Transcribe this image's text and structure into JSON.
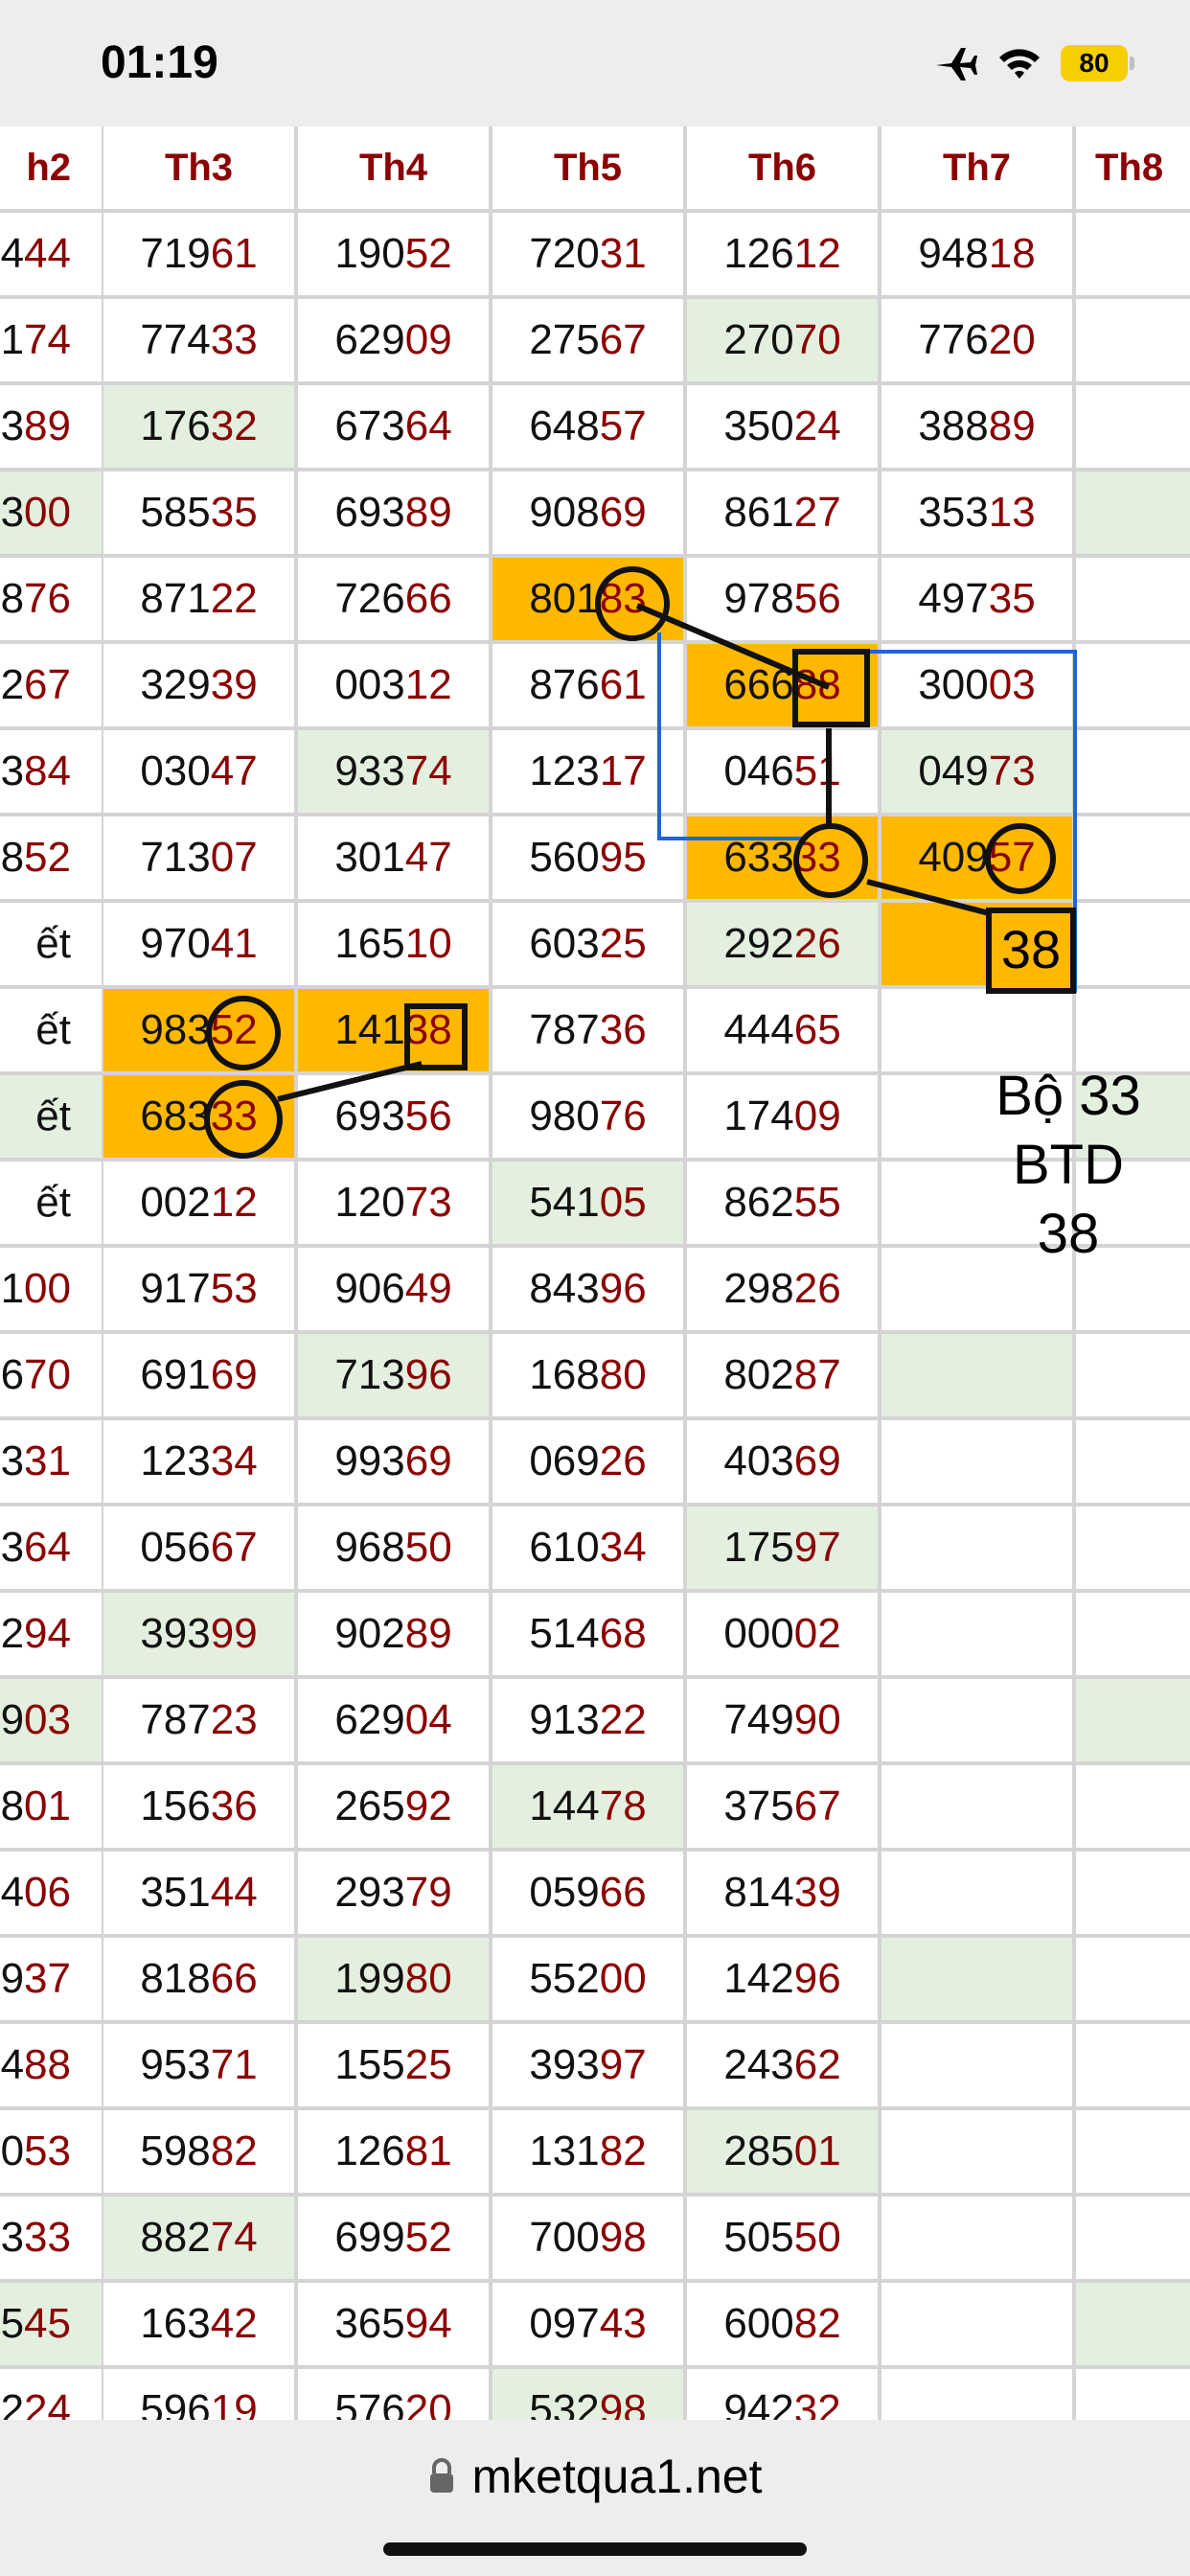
{
  "status": {
    "time": "01:19",
    "battery": "80"
  },
  "headers": [
    "h2",
    "Th3",
    "Th4",
    "Th5",
    "Th6",
    "Th7",
    "Th8"
  ],
  "rows": [
    {
      "c": [
        [
          "4",
          "44"
        ],
        [
          "719",
          "61"
        ],
        [
          "190",
          "52"
        ],
        [
          "720",
          "31"
        ],
        [
          "126",
          "12"
        ],
        [
          "948",
          "18"
        ],
        [
          "",
          ""
        ]
      ]
    },
    {
      "c": [
        [
          "1",
          "74"
        ],
        [
          "774",
          "33"
        ],
        [
          "629",
          "09"
        ],
        [
          "275",
          "67"
        ],
        [
          "270",
          "70"
        ],
        [
          "776",
          "20"
        ],
        [
          "",
          ""
        ]
      ]
    },
    {
      "c": [
        [
          "3",
          "89"
        ],
        [
          "176",
          "32"
        ],
        [
          "673",
          "64"
        ],
        [
          "648",
          "57"
        ],
        [
          "350",
          "24"
        ],
        [
          "388",
          "89"
        ],
        [
          "",
          ""
        ]
      ]
    },
    {
      "c": [
        [
          "3",
          "00"
        ],
        [
          "585",
          "35"
        ],
        [
          "693",
          "89"
        ],
        [
          "908",
          "69"
        ],
        [
          "861",
          "27"
        ],
        [
          "353",
          "13"
        ],
        [
          "",
          ""
        ]
      ]
    },
    {
      "c": [
        [
          "8",
          "76"
        ],
        [
          "871",
          "22"
        ],
        [
          "726",
          "66"
        ],
        [
          "801",
          "83"
        ],
        [
          "978",
          "56"
        ],
        [
          "497",
          "35"
        ],
        [
          "",
          ""
        ]
      ]
    },
    {
      "c": [
        [
          "2",
          "67"
        ],
        [
          "329",
          "39"
        ],
        [
          "003",
          "12"
        ],
        [
          "876",
          "61"
        ],
        [
          "666",
          "88"
        ],
        [
          "300",
          "03"
        ],
        [
          "",
          ""
        ]
      ]
    },
    {
      "c": [
        [
          "3",
          "84"
        ],
        [
          "030",
          "47"
        ],
        [
          "933",
          "74"
        ],
        [
          "123",
          "17"
        ],
        [
          "046",
          "51"
        ],
        [
          "049",
          "73"
        ],
        [
          "",
          ""
        ]
      ]
    },
    {
      "c": [
        [
          "8",
          "52"
        ],
        [
          "713",
          "07"
        ],
        [
          "301",
          "47"
        ],
        [
          "560",
          "95"
        ],
        [
          "633",
          "33"
        ],
        [
          "409",
          "57"
        ],
        [
          "",
          ""
        ]
      ]
    },
    {
      "c": [
        [
          "ết",
          ""
        ],
        [
          "970",
          "41"
        ],
        [
          "165",
          "10"
        ],
        [
          "603",
          "25"
        ],
        [
          "292",
          "26"
        ],
        [
          "",
          ""
        ],
        [
          "",
          ""
        ]
      ]
    },
    {
      "c": [
        [
          "ết",
          ""
        ],
        [
          "983",
          "52"
        ],
        [
          "141",
          "38"
        ],
        [
          "787",
          "36"
        ],
        [
          "444",
          "65"
        ],
        [
          "",
          ""
        ],
        [
          "",
          ""
        ]
      ]
    },
    {
      "c": [
        [
          "ết",
          ""
        ],
        [
          "683",
          "33"
        ],
        [
          "693",
          "56"
        ],
        [
          "980",
          "76"
        ],
        [
          "174",
          "09"
        ],
        [
          "",
          ""
        ],
        [
          "",
          ""
        ]
      ]
    },
    {
      "c": [
        [
          "ết",
          ""
        ],
        [
          "002",
          "12"
        ],
        [
          "120",
          "73"
        ],
        [
          "541",
          "05"
        ],
        [
          "862",
          "55"
        ],
        [
          "",
          ""
        ],
        [
          "",
          ""
        ]
      ]
    },
    {
      "c": [
        [
          "1",
          "00"
        ],
        [
          "917",
          "53"
        ],
        [
          "906",
          "49"
        ],
        [
          "843",
          "96"
        ],
        [
          "298",
          "26"
        ],
        [
          "",
          ""
        ],
        [
          "",
          ""
        ]
      ]
    },
    {
      "c": [
        [
          "6",
          "70"
        ],
        [
          "691",
          "69"
        ],
        [
          "713",
          "96"
        ],
        [
          "168",
          "80"
        ],
        [
          "802",
          "87"
        ],
        [
          "",
          ""
        ],
        [
          "",
          ""
        ]
      ]
    },
    {
      "c": [
        [
          "3",
          "31"
        ],
        [
          "123",
          "34"
        ],
        [
          "993",
          "69"
        ],
        [
          "069",
          "26"
        ],
        [
          "403",
          "69"
        ],
        [
          "",
          ""
        ],
        [
          "",
          ""
        ]
      ]
    },
    {
      "c": [
        [
          "3",
          "64"
        ],
        [
          "056",
          "67"
        ],
        [
          "968",
          "50"
        ],
        [
          "610",
          "34"
        ],
        [
          "175",
          "97"
        ],
        [
          "",
          ""
        ],
        [
          "",
          ""
        ]
      ]
    },
    {
      "c": [
        [
          "2",
          "94"
        ],
        [
          "393",
          "99"
        ],
        [
          "902",
          "89"
        ],
        [
          "514",
          "68"
        ],
        [
          "000",
          "02"
        ],
        [
          "",
          ""
        ],
        [
          "",
          ""
        ]
      ]
    },
    {
      "c": [
        [
          "9",
          "03"
        ],
        [
          "787",
          "23"
        ],
        [
          "629",
          "04"
        ],
        [
          "913",
          "22"
        ],
        [
          "749",
          "90"
        ],
        [
          "",
          ""
        ],
        [
          "",
          ""
        ]
      ]
    },
    {
      "c": [
        [
          "8",
          "01"
        ],
        [
          "156",
          "36"
        ],
        [
          "265",
          "92"
        ],
        [
          "144",
          "78"
        ],
        [
          "375",
          "67"
        ],
        [
          "",
          ""
        ],
        [
          "",
          ""
        ]
      ]
    },
    {
      "c": [
        [
          "4",
          "06"
        ],
        [
          "351",
          "44"
        ],
        [
          "293",
          "79"
        ],
        [
          "059",
          "66"
        ],
        [
          "814",
          "39"
        ],
        [
          "",
          ""
        ],
        [
          "",
          ""
        ]
      ]
    },
    {
      "c": [
        [
          "9",
          "37"
        ],
        [
          "818",
          "66"
        ],
        [
          "199",
          "80"
        ],
        [
          "552",
          "00"
        ],
        [
          "142",
          "96"
        ],
        [
          "",
          ""
        ],
        [
          "",
          ""
        ]
      ]
    },
    {
      "c": [
        [
          "4",
          "88"
        ],
        [
          "953",
          "71"
        ],
        [
          "155",
          "25"
        ],
        [
          "393",
          "97"
        ],
        [
          "243",
          "62"
        ],
        [
          "",
          ""
        ],
        [
          "",
          ""
        ]
      ]
    },
    {
      "c": [
        [
          "0",
          "53"
        ],
        [
          "598",
          "82"
        ],
        [
          "126",
          "81"
        ],
        [
          "131",
          "82"
        ],
        [
          "285",
          "01"
        ],
        [
          "",
          ""
        ],
        [
          "",
          ""
        ]
      ]
    },
    {
      "c": [
        [
          "3",
          "33"
        ],
        [
          "882",
          "74"
        ],
        [
          "699",
          "52"
        ],
        [
          "700",
          "98"
        ],
        [
          "505",
          "50"
        ],
        [
          "",
          ""
        ],
        [
          "",
          ""
        ]
      ]
    },
    {
      "c": [
        [
          "5",
          "45"
        ],
        [
          "163",
          "42"
        ],
        [
          "365",
          "94"
        ],
        [
          "097",
          "43"
        ],
        [
          "600",
          "82"
        ],
        [
          "",
          ""
        ],
        [
          "",
          ""
        ]
      ]
    },
    {
      "c": [
        [
          "2",
          "24"
        ],
        [
          "596",
          "19"
        ],
        [
          "576",
          "20"
        ],
        [
          "532",
          "98"
        ],
        [
          "942",
          "32"
        ],
        [
          "",
          ""
        ],
        [
          "",
          ""
        ]
      ]
    }
  ],
  "highlights": {
    "green": [
      [
        1,
        4
      ],
      [
        2,
        1
      ],
      [
        3,
        0
      ],
      [
        3,
        6
      ],
      [
        6,
        2
      ],
      [
        6,
        5
      ],
      [
        8,
        4
      ],
      [
        10,
        0
      ],
      [
        10,
        6
      ],
      [
        11,
        3
      ],
      [
        13,
        2
      ],
      [
        13,
        5
      ],
      [
        15,
        4
      ],
      [
        16,
        1
      ],
      [
        17,
        0
      ],
      [
        17,
        6
      ],
      [
        18,
        3
      ],
      [
        20,
        2
      ],
      [
        20,
        5
      ],
      [
        22,
        4
      ],
      [
        23,
        1
      ],
      [
        24,
        0
      ],
      [
        24,
        6
      ],
      [
        25,
        3
      ]
    ],
    "orange": [
      [
        4,
        3
      ],
      [
        5,
        4
      ],
      [
        7,
        4
      ],
      [
        7,
        5
      ],
      [
        8,
        5
      ],
      [
        9,
        1
      ],
      [
        9,
        2
      ],
      [
        10,
        1
      ]
    ]
  },
  "annotation": {
    "line1": "Bộ 33",
    "line2": "BTD",
    "line3": "38",
    "big_number": "38"
  },
  "url": "mketqua1.net",
  "colors": {
    "accent_red": "#8b0000",
    "highlight_orange": "#ffb800",
    "highlight_green": "#e3f0df",
    "frame_blue": "#1e64dc"
  }
}
